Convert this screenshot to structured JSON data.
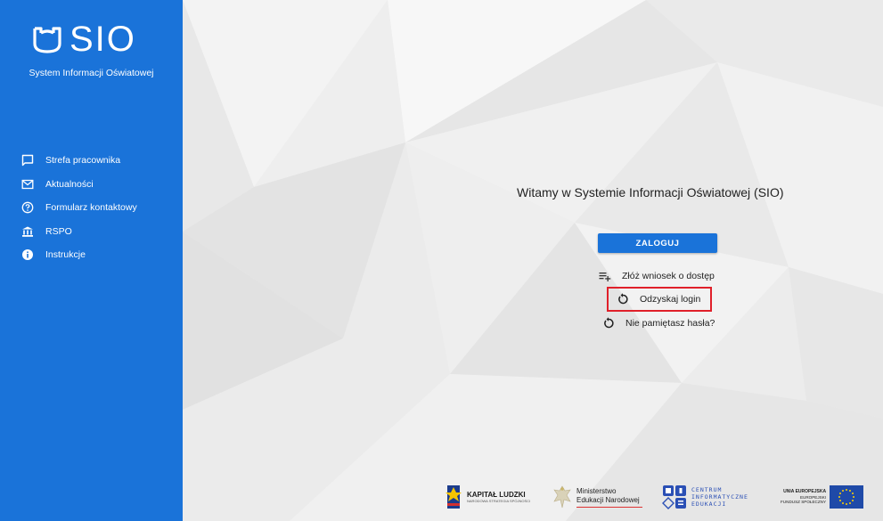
{
  "sidebar": {
    "logo_text": "SIO",
    "subtitle": "System Informacji Oświatowej",
    "items": [
      {
        "label": "Strefa pracownika",
        "icon": "chat-bubble-icon"
      },
      {
        "label": "Aktualności",
        "icon": "mail-icon"
      },
      {
        "label": "Formularz kontaktowy",
        "icon": "help-circle-icon"
      },
      {
        "label": "RSPO",
        "icon": "bank-icon"
      },
      {
        "label": "Instrukcje",
        "icon": "info-icon"
      }
    ]
  },
  "main": {
    "welcome": "Witamy w Systemie Informacji Oświatowej (SIO)",
    "login_button": "ZALOGUJ",
    "actions": [
      {
        "label": "Złóż wniosek o dostęp",
        "icon": "playlist-add-icon"
      },
      {
        "label": "Odzyskaj login",
        "icon": "restore-icon"
      },
      {
        "label": "Nie pamiętasz hasła?",
        "icon": "restore-icon"
      }
    ],
    "highlight_color": "#e0202a"
  },
  "footer": {
    "kapital_ludzki": "KAPITAŁ LUDZKI",
    "kapital_sub": "NARODOWA STRATEGIA SPÓJNOŚCI",
    "men_line1": "Ministerstwo",
    "men_line2": "Edukacji Narodowej",
    "cie_line1": "CENTRUM",
    "cie_line2": "INFORMATYCZNE",
    "cie_line3": "EDUKACJI",
    "ue_line1": "UNIA EUROPEJSKA",
    "ue_line2": "EUROPEJSKI",
    "ue_line3": "FUNDUSZ SPOŁECZNY"
  },
  "colors": {
    "brand": "#1a73d9",
    "background": "#ebebeb"
  }
}
